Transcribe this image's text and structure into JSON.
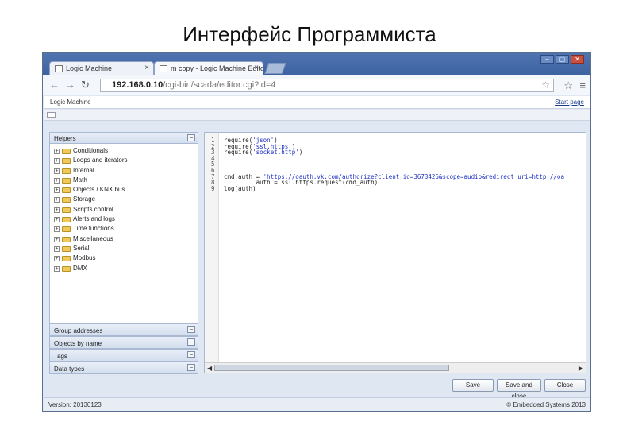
{
  "slide_title": "Интерфейс Программиста",
  "browser": {
    "tabs": [
      {
        "label": "Logic Machine",
        "close": "×"
      },
      {
        "label": "m copy - Logic Machine Edito",
        "close": "×"
      }
    ],
    "window_controls": [
      "‒",
      "▢",
      "✕"
    ],
    "url_main": "192.168.0.10",
    "url_rest": "/cgi-bin/scada/editor.cgi?id=4"
  },
  "page": {
    "brand": "Logic Machine",
    "start_page_link": "Start page"
  },
  "helpers": {
    "header": "Helpers",
    "collapse_symbol": "−",
    "items": [
      "Conditionals",
      "Loops and iterators",
      "Internal",
      "Math",
      "Objects / KNX bus",
      "Storage",
      "Scripts control",
      "Alerts and logs",
      "Time functions",
      "Miscellaneous",
      "Serial",
      "Modbus",
      "DMX"
    ]
  },
  "accordion": [
    "Group addresses",
    "Objects by name",
    "Tags",
    "Data types"
  ],
  "editor": {
    "line_numbers": [
      "1",
      "2",
      "3",
      "4",
      "5",
      "6",
      "7",
      "8",
      "9"
    ],
    "lines": [
      {
        "pre": "require(",
        "str": "'json'",
        "post": ")"
      },
      {
        "pre": "require(",
        "str": "'ssl.https'",
        "post": ")"
      },
      {
        "pre": "require(",
        "str": "'socket.http'",
        "post": ")"
      },
      {
        "pre": "",
        "str": "",
        "post": ""
      },
      {
        "pre": "",
        "str": "",
        "post": ""
      },
      {
        "pre": "",
        "str": "",
        "post": ""
      },
      {
        "pre": "cmd_auth = ",
        "str": "'https://oauth.vk.com/authorize?client_id=3673426&scope=audio&redirect_uri=http://oa",
        "post": ""
      },
      {
        "pre": "         auth = ssl.https.request(cmd_auth)",
        "str": "",
        "post": ""
      },
      {
        "pre": "log(auth)",
        "str": "",
        "post": ""
      }
    ]
  },
  "buttons": {
    "save": "Save",
    "save_close": "Save and close",
    "close": "Close"
  },
  "footer": {
    "version": "Version: 20130123",
    "copyright": "© Embedded Systems 2013"
  }
}
